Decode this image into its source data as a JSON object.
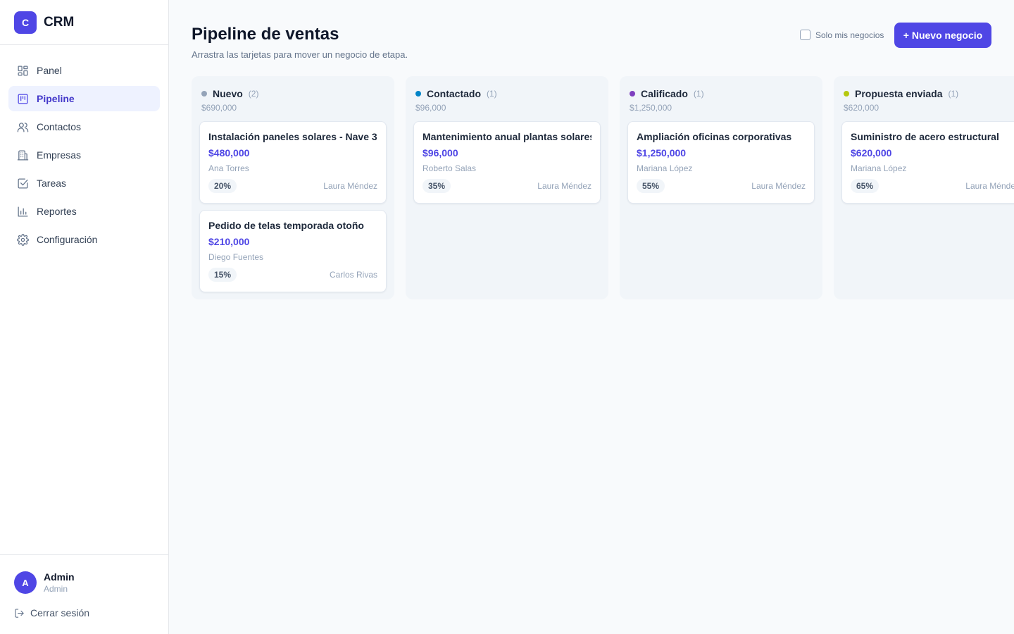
{
  "brand": {
    "logo_letter": "C",
    "name": "CRM",
    "accent": "#4f46e5"
  },
  "nav": [
    {
      "label": "Panel",
      "icon": "dashboard-icon",
      "active": false
    },
    {
      "label": "Pipeline",
      "icon": "kanban-icon",
      "active": true
    },
    {
      "label": "Contactos",
      "icon": "users-icon",
      "active": false
    },
    {
      "label": "Empresas",
      "icon": "building-icon",
      "active": false
    },
    {
      "label": "Tareas",
      "icon": "checkbox-icon",
      "active": false
    },
    {
      "label": "Reportes",
      "icon": "bar-chart-icon",
      "active": false
    },
    {
      "label": "Configuración",
      "icon": "gear-icon",
      "active": false
    }
  ],
  "user": {
    "initial": "A",
    "name": "Admin",
    "role": "Admin",
    "logout_label": "Cerrar sesión"
  },
  "header": {
    "title": "Pipeline de ventas",
    "subtitle": "Arrastra las tarjetas para mover un negocio de etapa.",
    "filter_label": "Solo mis negocios",
    "filter_checked": false,
    "new_button_label": "+ Nuevo negocio"
  },
  "columns": [
    {
      "name": "Nuevo",
      "count": "(2)",
      "total": "$690,000",
      "color": "#94a3b8",
      "cards": [
        {
          "title": "Instalación paneles solares - Nave 3",
          "amount": "$480,000",
          "contact": "Ana Torres",
          "probability": "20%",
          "owner": "Laura Méndez"
        },
        {
          "title": "Pedido de telas temporada otoño",
          "amount": "$210,000",
          "contact": "Diego Fuentes",
          "probability": "15%",
          "owner": "Carlos Rivas"
        }
      ]
    },
    {
      "name": "Contactado",
      "count": "(1)",
      "total": "$96,000",
      "color": "#0284c7",
      "cards": [
        {
          "title": "Mantenimiento anual plantas solares",
          "amount": "$96,000",
          "contact": "Roberto Salas",
          "probability": "35%",
          "owner": "Laura Méndez"
        }
      ]
    },
    {
      "name": "Calificado",
      "count": "(1)",
      "total": "$1,250,000",
      "color": "#7e3fbf",
      "cards": [
        {
          "title": "Ampliación oficinas corporativas",
          "amount": "$1,250,000",
          "contact": "Mariana López",
          "probability": "55%",
          "owner": "Laura Méndez"
        }
      ]
    },
    {
      "name": "Propuesta enviada",
      "count": "(1)",
      "total": "$620,000",
      "color": "#b5c80f",
      "cards": [
        {
          "title": "Suministro de acero estructural",
          "amount": "$620,000",
          "contact": "Mariana López",
          "probability": "65%",
          "owner": "Laura Méndez"
        }
      ]
    }
  ]
}
